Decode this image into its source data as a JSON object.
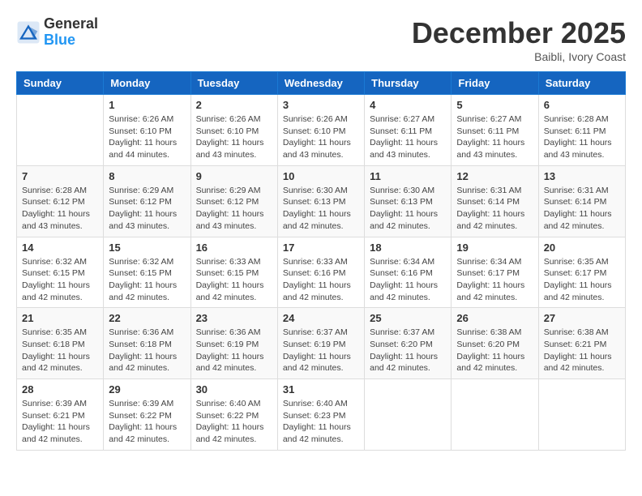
{
  "logo": {
    "general": "General",
    "blue": "Blue"
  },
  "header": {
    "month": "December 2025",
    "location": "Baibli, Ivory Coast"
  },
  "weekdays": [
    "Sunday",
    "Monday",
    "Tuesday",
    "Wednesday",
    "Thursday",
    "Friday",
    "Saturday"
  ],
  "weeks": [
    [
      {
        "day": "",
        "info": ""
      },
      {
        "day": "1",
        "info": "Sunrise: 6:26 AM\nSunset: 6:10 PM\nDaylight: 11 hours\nand 44 minutes."
      },
      {
        "day": "2",
        "info": "Sunrise: 6:26 AM\nSunset: 6:10 PM\nDaylight: 11 hours\nand 43 minutes."
      },
      {
        "day": "3",
        "info": "Sunrise: 6:26 AM\nSunset: 6:10 PM\nDaylight: 11 hours\nand 43 minutes."
      },
      {
        "day": "4",
        "info": "Sunrise: 6:27 AM\nSunset: 6:11 PM\nDaylight: 11 hours\nand 43 minutes."
      },
      {
        "day": "5",
        "info": "Sunrise: 6:27 AM\nSunset: 6:11 PM\nDaylight: 11 hours\nand 43 minutes."
      },
      {
        "day": "6",
        "info": "Sunrise: 6:28 AM\nSunset: 6:11 PM\nDaylight: 11 hours\nand 43 minutes."
      }
    ],
    [
      {
        "day": "7",
        "info": "Sunrise: 6:28 AM\nSunset: 6:12 PM\nDaylight: 11 hours\nand 43 minutes."
      },
      {
        "day": "8",
        "info": "Sunrise: 6:29 AM\nSunset: 6:12 PM\nDaylight: 11 hours\nand 43 minutes."
      },
      {
        "day": "9",
        "info": "Sunrise: 6:29 AM\nSunset: 6:12 PM\nDaylight: 11 hours\nand 43 minutes."
      },
      {
        "day": "10",
        "info": "Sunrise: 6:30 AM\nSunset: 6:13 PM\nDaylight: 11 hours\nand 42 minutes."
      },
      {
        "day": "11",
        "info": "Sunrise: 6:30 AM\nSunset: 6:13 PM\nDaylight: 11 hours\nand 42 minutes."
      },
      {
        "day": "12",
        "info": "Sunrise: 6:31 AM\nSunset: 6:14 PM\nDaylight: 11 hours\nand 42 minutes."
      },
      {
        "day": "13",
        "info": "Sunrise: 6:31 AM\nSunset: 6:14 PM\nDaylight: 11 hours\nand 42 minutes."
      }
    ],
    [
      {
        "day": "14",
        "info": "Sunrise: 6:32 AM\nSunset: 6:15 PM\nDaylight: 11 hours\nand 42 minutes."
      },
      {
        "day": "15",
        "info": "Sunrise: 6:32 AM\nSunset: 6:15 PM\nDaylight: 11 hours\nand 42 minutes."
      },
      {
        "day": "16",
        "info": "Sunrise: 6:33 AM\nSunset: 6:15 PM\nDaylight: 11 hours\nand 42 minutes."
      },
      {
        "day": "17",
        "info": "Sunrise: 6:33 AM\nSunset: 6:16 PM\nDaylight: 11 hours\nand 42 minutes."
      },
      {
        "day": "18",
        "info": "Sunrise: 6:34 AM\nSunset: 6:16 PM\nDaylight: 11 hours\nand 42 minutes."
      },
      {
        "day": "19",
        "info": "Sunrise: 6:34 AM\nSunset: 6:17 PM\nDaylight: 11 hours\nand 42 minutes."
      },
      {
        "day": "20",
        "info": "Sunrise: 6:35 AM\nSunset: 6:17 PM\nDaylight: 11 hours\nand 42 minutes."
      }
    ],
    [
      {
        "day": "21",
        "info": "Sunrise: 6:35 AM\nSunset: 6:18 PM\nDaylight: 11 hours\nand 42 minutes."
      },
      {
        "day": "22",
        "info": "Sunrise: 6:36 AM\nSunset: 6:18 PM\nDaylight: 11 hours\nand 42 minutes."
      },
      {
        "day": "23",
        "info": "Sunrise: 6:36 AM\nSunset: 6:19 PM\nDaylight: 11 hours\nand 42 minutes."
      },
      {
        "day": "24",
        "info": "Sunrise: 6:37 AM\nSunset: 6:19 PM\nDaylight: 11 hours\nand 42 minutes."
      },
      {
        "day": "25",
        "info": "Sunrise: 6:37 AM\nSunset: 6:20 PM\nDaylight: 11 hours\nand 42 minutes."
      },
      {
        "day": "26",
        "info": "Sunrise: 6:38 AM\nSunset: 6:20 PM\nDaylight: 11 hours\nand 42 minutes."
      },
      {
        "day": "27",
        "info": "Sunrise: 6:38 AM\nSunset: 6:21 PM\nDaylight: 11 hours\nand 42 minutes."
      }
    ],
    [
      {
        "day": "28",
        "info": "Sunrise: 6:39 AM\nSunset: 6:21 PM\nDaylight: 11 hours\nand 42 minutes."
      },
      {
        "day": "29",
        "info": "Sunrise: 6:39 AM\nSunset: 6:22 PM\nDaylight: 11 hours\nand 42 minutes."
      },
      {
        "day": "30",
        "info": "Sunrise: 6:40 AM\nSunset: 6:22 PM\nDaylight: 11 hours\nand 42 minutes."
      },
      {
        "day": "31",
        "info": "Sunrise: 6:40 AM\nSunset: 6:23 PM\nDaylight: 11 hours\nand 42 minutes."
      },
      {
        "day": "",
        "info": ""
      },
      {
        "day": "",
        "info": ""
      },
      {
        "day": "",
        "info": ""
      }
    ]
  ]
}
